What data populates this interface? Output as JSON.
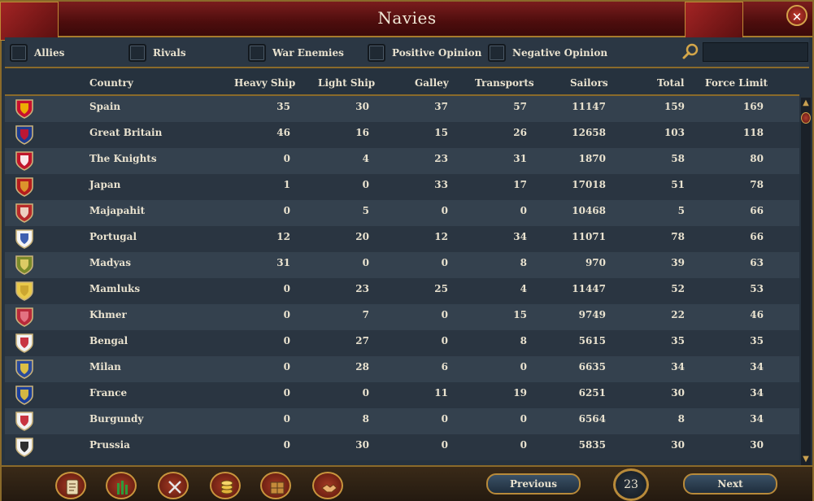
{
  "window": {
    "title": "Navies",
    "close_glyph": "✕"
  },
  "filters": [
    {
      "label": "Allies"
    },
    {
      "label": "Rivals"
    },
    {
      "label": "War Enemies"
    },
    {
      "label": "Positive Opinion"
    },
    {
      "label": "Negative Opinion"
    }
  ],
  "search": {
    "value": "",
    "icon": "magnifier-icon"
  },
  "columns": [
    "Country",
    "Heavy Ship",
    "Light Ship",
    "Galley",
    "Transports",
    "Sailors",
    "Total",
    "Force Limit"
  ],
  "rows": [
    {
      "country": "Spain",
      "heavy": "35",
      "light": "30",
      "galley": "37",
      "transports": "57",
      "sailors": "11147",
      "total": "159",
      "force_limit": "169",
      "flag": [
        "#c8102e",
        "#f1bf00"
      ]
    },
    {
      "country": "Great Britain",
      "heavy": "46",
      "light": "16",
      "galley": "15",
      "transports": "26",
      "sailors": "12658",
      "total": "103",
      "force_limit": "118",
      "flag": [
        "#1f3b8f",
        "#cf142b"
      ]
    },
    {
      "country": "The Knights",
      "heavy": "0",
      "light": "4",
      "galley": "23",
      "transports": "31",
      "sailors": "1870",
      "total": "58",
      "force_limit": "80",
      "flag": [
        "#c0162b",
        "#ffffff"
      ]
    },
    {
      "country": "Japan",
      "heavy": "1",
      "light": "0",
      "galley": "33",
      "transports": "17",
      "sailors": "17018",
      "total": "51",
      "force_limit": "78",
      "flag": [
        "#b51d1d",
        "#e0a22f"
      ]
    },
    {
      "country": "Majapahit",
      "heavy": "0",
      "light": "5",
      "galley": "0",
      "transports": "0",
      "sailors": "10468",
      "total": "5",
      "force_limit": "66",
      "flag": [
        "#b82a2a",
        "#f3e3d0"
      ]
    },
    {
      "country": "Portugal",
      "heavy": "12",
      "light": "20",
      "galley": "12",
      "transports": "34",
      "sailors": "11071",
      "total": "78",
      "force_limit": "66",
      "flag": [
        "#f4f4f4",
        "#2a4fa8"
      ]
    },
    {
      "country": "Madyas",
      "heavy": "31",
      "light": "0",
      "galley": "0",
      "transports": "8",
      "sailors": "970",
      "total": "39",
      "force_limit": "63",
      "flag": [
        "#7a8a2a",
        "#e8d06a"
      ]
    },
    {
      "country": "Mamluks",
      "heavy": "0",
      "light": "23",
      "galley": "25",
      "transports": "4",
      "sailors": "11447",
      "total": "52",
      "force_limit": "53",
      "flag": [
        "#e9c94a",
        "#c9a22d"
      ]
    },
    {
      "country": "Khmer",
      "heavy": "0",
      "light": "7",
      "galley": "0",
      "transports": "15",
      "sailors": "9749",
      "total": "22",
      "force_limit": "46",
      "flag": [
        "#b82a3a",
        "#e87a8a"
      ]
    },
    {
      "country": "Bengal",
      "heavy": "0",
      "light": "27",
      "galley": "0",
      "transports": "8",
      "sailors": "5615",
      "total": "35",
      "force_limit": "35",
      "flag": [
        "#f2f2f2",
        "#c31f2e"
      ]
    },
    {
      "country": "Milan",
      "heavy": "0",
      "light": "28",
      "galley": "6",
      "transports": "0",
      "sailors": "6635",
      "total": "34",
      "force_limit": "34",
      "flag": [
        "#2b4a9a",
        "#f1cc3b"
      ]
    },
    {
      "country": "France",
      "heavy": "0",
      "light": "0",
      "galley": "11",
      "transports": "19",
      "sailors": "6251",
      "total": "30",
      "force_limit": "34",
      "flag": [
        "#1c3f9a",
        "#e8c43a"
      ]
    },
    {
      "country": "Burgundy",
      "heavy": "0",
      "light": "8",
      "galley": "0",
      "transports": "0",
      "sailors": "6564",
      "total": "8",
      "force_limit": "34",
      "flag": [
        "#f2f2f2",
        "#c31f2e"
      ]
    },
    {
      "country": "Prussia",
      "heavy": "0",
      "light": "30",
      "galley": "0",
      "transports": "0",
      "sailors": "5835",
      "total": "30",
      "force_limit": "30",
      "flag": [
        "#f2f2f2",
        "#1a1a1a"
      ]
    }
  ],
  "toolbar": [
    {
      "name": "ledger-button",
      "icon": "scroll-icon"
    },
    {
      "name": "army-button",
      "icon": "flag-bars-icon"
    },
    {
      "name": "military-button",
      "icon": "crossed-swords-icon"
    },
    {
      "name": "economy-button",
      "icon": "coins-icon"
    },
    {
      "name": "trade-button",
      "icon": "crate-icon"
    },
    {
      "name": "diplomacy-button",
      "icon": "handshake-icon"
    }
  ],
  "pagination": {
    "previous_label": "Previous",
    "next_label": "Next",
    "page": "23"
  }
}
